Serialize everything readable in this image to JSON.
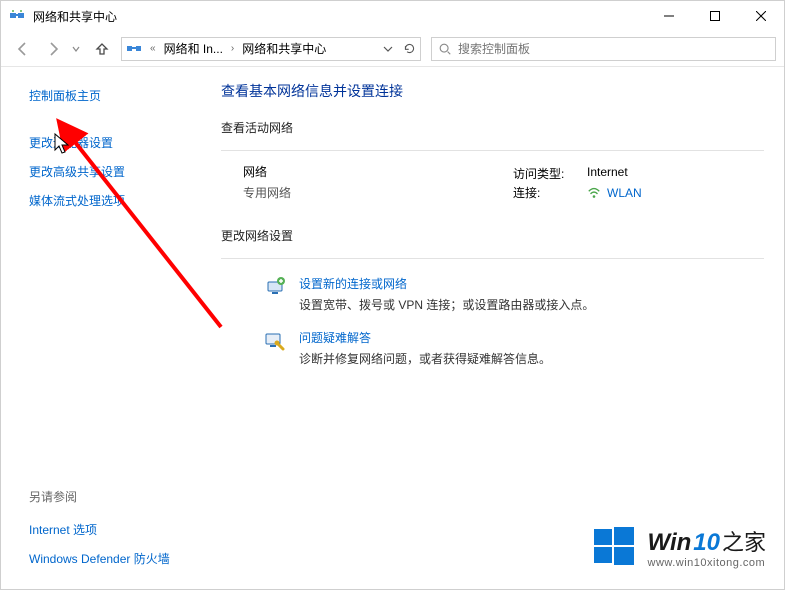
{
  "window": {
    "title": "网络和共享中心"
  },
  "breadcrumb": {
    "root": "«",
    "part1": "网络和 In...",
    "part2": "网络和共享中心"
  },
  "search": {
    "placeholder": "搜索控制面板"
  },
  "sidebar": {
    "home": "控制面板主页",
    "links": [
      "更改适配器设置",
      "更改高级共享设置",
      "媒体流式处理选项"
    ],
    "see_also_label": "另请参阅",
    "see_also": [
      "Internet 选项",
      "Windows Defender 防火墙"
    ]
  },
  "content": {
    "heading": "查看基本网络信息并设置连接",
    "active_header": "查看活动网络",
    "network_name": "网络",
    "network_type": "专用网络",
    "access_label": "访问类型:",
    "access_value": "Internet",
    "conn_label": "连接:",
    "conn_value": "WLAN",
    "change_header": "更改网络设置",
    "opt1_title": "设置新的连接或网络",
    "opt1_desc": "设置宽带、拨号或 VPN 连接；或设置路由器或接入点。",
    "opt2_title": "问题疑难解答",
    "opt2_desc": "诊断并修复网络问题，或者获得疑难解答信息。"
  },
  "watermark": {
    "brand_a": "Win",
    "brand_b": "10",
    "brand_c": "之家",
    "url": "www.win10xitong.com"
  }
}
